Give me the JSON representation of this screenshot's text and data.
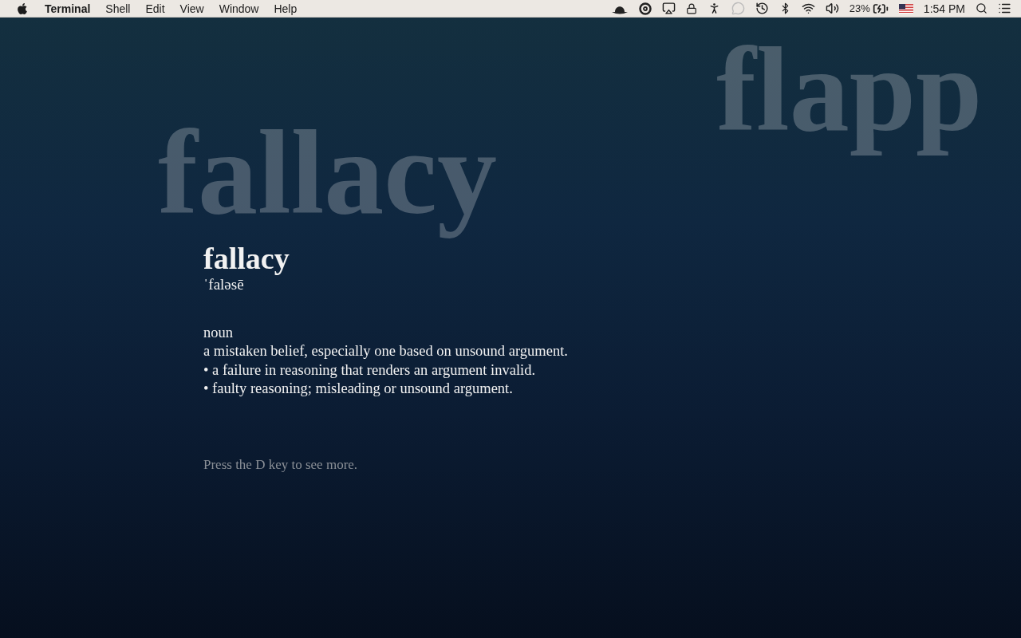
{
  "menu_bar": {
    "app_name": "Terminal",
    "menus": [
      "Shell",
      "Edit",
      "View",
      "Window",
      "Help"
    ],
    "battery": "23%",
    "clock": "1:54 PM"
  },
  "background_words": [
    "fallacy",
    "flapp"
  ],
  "entry": {
    "word": "fallacy",
    "pronunciation": "ˈfaləsē",
    "part_of_speech": "noun",
    "definitions": [
      "a mistaken belief, especially one based on unsound argument.",
      "• a failure in reasoning that renders an argument invalid.",
      "• faulty reasoning; misleading or unsound argument."
    ],
    "hint": "Press the D key to see more."
  }
}
